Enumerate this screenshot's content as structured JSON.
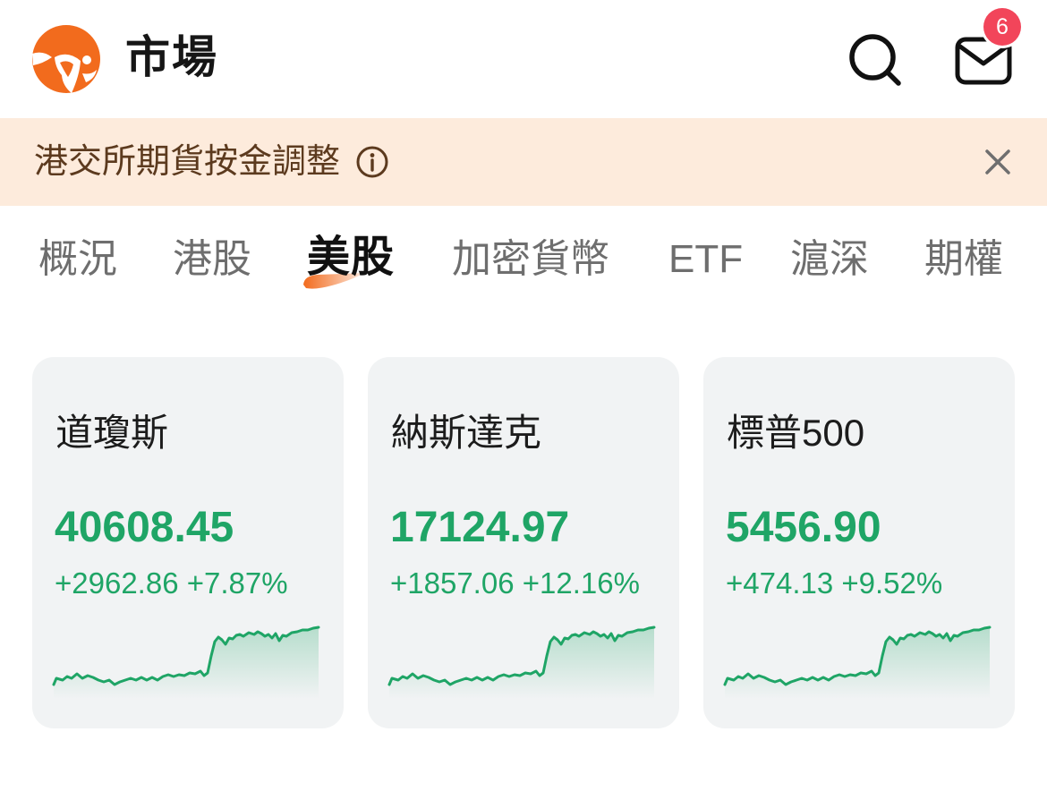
{
  "header": {
    "title": "市場",
    "logo_icon": "moomoo-logo",
    "search_icon": "search-icon",
    "mail_icon": "mail-icon",
    "mail_badge": "6"
  },
  "banner": {
    "text": "港交所期貨按金調整",
    "info_icon": "info-icon",
    "close_icon": "close-icon"
  },
  "tabs": [
    {
      "label": "概況"
    },
    {
      "label": "港股"
    },
    {
      "label": "美股"
    },
    {
      "label": "加密貨幣"
    },
    {
      "label": "ETF"
    },
    {
      "label": "滬深"
    },
    {
      "label": "期權"
    }
  ],
  "active_tab_index": 2,
  "indices": [
    {
      "name": "道瓊斯",
      "value": "40608.45",
      "change": "+2962.86",
      "change_pct": "+7.87%",
      "trend": "up"
    },
    {
      "name": "納斯達克",
      "value": "17124.97",
      "change": "+1857.06",
      "change_pct": "+12.16%",
      "trend": "up"
    },
    {
      "name": "標普500",
      "value": "5456.90",
      "change": "+474.13",
      "change_pct": "+9.52%",
      "trend": "up"
    }
  ],
  "colors": {
    "brand_orange": "#F26B1D",
    "up_green": "#1FA566",
    "badge_red": "#F2455A",
    "banner_bg": "#FDEBDC",
    "banner_text": "#5C3A1E",
    "card_bg": "#F1F3F4",
    "tab_inactive": "#6E6E6E"
  }
}
